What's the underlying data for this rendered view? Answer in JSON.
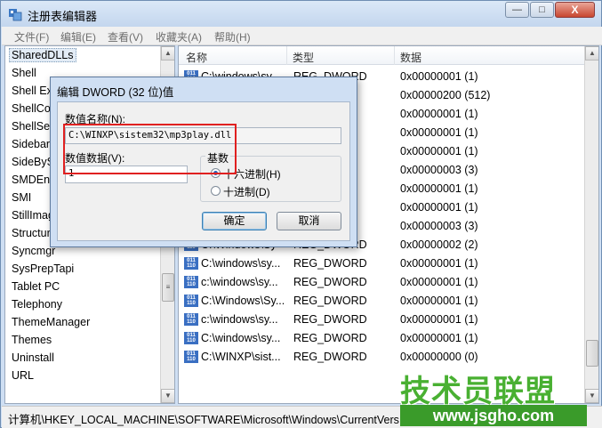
{
  "window": {
    "title": "注册表编辑器",
    "controls": {
      "minimize": "—",
      "maximize": "□",
      "close": "X"
    }
  },
  "menu": [
    "文件(F)",
    "编辑(E)",
    "查看(V)",
    "收藏夹(A)",
    "帮助(H)"
  ],
  "tree": {
    "items": [
      "SharedDLLs",
      "Shell",
      "Shell Ex",
      "ShellCo",
      "ShellSer",
      "Sidebar",
      "SideBySi",
      "SMDEn",
      "SMI",
      "StillImag",
      "Structur",
      "Syncmgr",
      "SysPrepTapi",
      "Tablet PC",
      "Telephony",
      "ThemeManager",
      "Themes",
      "Uninstall",
      "URL"
    ],
    "selected_index": 0
  },
  "list": {
    "headers": {
      "name": "名称",
      "type": "类型",
      "data": "数据"
    },
    "rows": [
      {
        "name": "C:\\windows\\sy",
        "type": "REG_DWORD",
        "data": "0x00000001 (1)"
      },
      {
        "name": "",
        "type": "",
        "data": "0x00000200 (512)"
      },
      {
        "name": "",
        "type": "",
        "data": "0x00000001 (1)"
      },
      {
        "name": "",
        "type": "",
        "data": "0x00000001 (1)"
      },
      {
        "name": "",
        "type": "",
        "data": "0x00000001 (1)"
      },
      {
        "name": "",
        "type": "",
        "data": "0x00000003 (3)"
      },
      {
        "name": "",
        "type": "",
        "data": "0x00000001 (1)"
      },
      {
        "name": "",
        "type": "",
        "data": "0x00000001 (1)"
      },
      {
        "name": "",
        "type": "",
        "data": "0x00000003 (3)"
      },
      {
        "name": "C:\\Windows\\Sy",
        "type": "REG_DWORD",
        "data": "0x00000002 (2)"
      },
      {
        "name": "C:\\windows\\sy...",
        "type": "REG_DWORD",
        "data": "0x00000001 (1)"
      },
      {
        "name": "c:\\windows\\sy...",
        "type": "REG_DWORD",
        "data": "0x00000001 (1)"
      },
      {
        "name": "C:\\Windows\\Sy...",
        "type": "REG_DWORD",
        "data": "0x00000001 (1)"
      },
      {
        "name": "c:\\windows\\sy...",
        "type": "REG_DWORD",
        "data": "0x00000001 (1)"
      },
      {
        "name": "C:\\windows\\sy...",
        "type": "REG_DWORD",
        "data": "0x00000001 (1)"
      },
      {
        "name": "C:\\WINXP\\sist...",
        "type": "REG_DWORD",
        "data": "0x00000000 (0)"
      }
    ]
  },
  "statusbar": {
    "path": "计算机\\HKEY_LOCAL_MACHINE\\SOFTWARE\\Microsoft\\Windows\\CurrentVers"
  },
  "dialog": {
    "title": "编辑 DWORD (32 位)值",
    "name_label": "数值名称(N):",
    "name_value": "C:\\WINXP\\sistem32\\mp3play.dll",
    "data_label": "数值数据(V):",
    "data_value": "1",
    "base_label": "基数",
    "radio_hex": "十六进制(H)",
    "radio_dec": "十进制(D)",
    "selected_base": "hex",
    "ok_label": "确定",
    "cancel_label": "取消",
    "highlight_color": "#e02020"
  },
  "watermark": {
    "title": "技术员联盟",
    "url": "www.jsgho.com"
  },
  "icons": {
    "value_icon": "reg-dword-icon",
    "app_icon": "regedit-icon"
  }
}
